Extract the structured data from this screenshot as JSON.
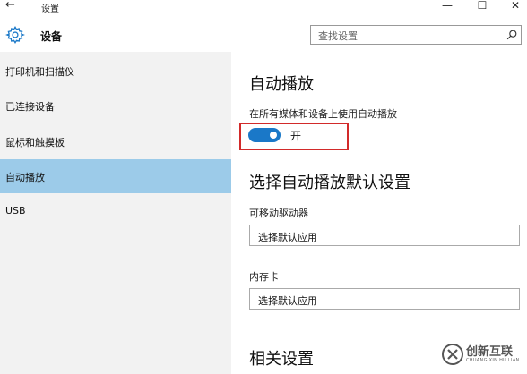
{
  "window": {
    "back_icon": "←",
    "title": "设置",
    "minimize": "—",
    "maximize": "☐",
    "close": "✕"
  },
  "header": {
    "app_title": "设备",
    "search_placeholder": "查找设置",
    "icon": "gear-icon"
  },
  "sidebar": {
    "items": [
      {
        "label": "打印机和扫描仪",
        "active": false
      },
      {
        "label": "已连接设备",
        "active": false
      },
      {
        "label": "鼠标和触摸板",
        "active": false
      },
      {
        "label": "自动播放",
        "active": true
      },
      {
        "label": "USB",
        "active": false
      }
    ]
  },
  "content": {
    "heading_autoplay": "自动播放",
    "autoplay_label": "在所有媒体和设备上使用自动播放",
    "toggle_state": "开",
    "heading_defaults": "选择自动播放默认设置",
    "removable_label": "可移动驱动器",
    "removable_value": "选择默认应用",
    "memcard_label": "内存卡",
    "memcard_value": "选择默认应用",
    "heading_related": "相关设置"
  },
  "watermark": {
    "text": "创新互联",
    "sub": "CHUANG XIN HU LIAN"
  },
  "colors": {
    "accent": "#1a78c8",
    "active_nav": "#9ccbe9",
    "highlight_box": "#d22a2a",
    "sidebar_bg": "#f2f2f2"
  }
}
